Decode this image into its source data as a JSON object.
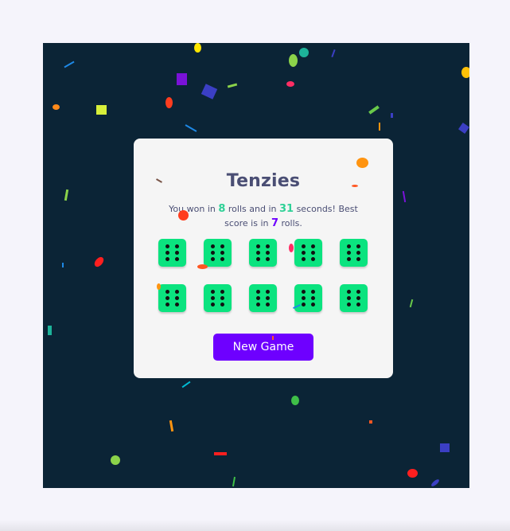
{
  "game": {
    "title": "Tenzies",
    "message": {
      "part1": "You won in ",
      "rolls": "8",
      "part2": " rolls and in ",
      "seconds": "31",
      "part3": " seconds! Best score is in ",
      "best": "7",
      "part4": " rolls."
    },
    "dice": [
      {
        "value": 6,
        "held": true
      },
      {
        "value": 6,
        "held": true
      },
      {
        "value": 6,
        "held": true
      },
      {
        "value": 6,
        "held": true
      },
      {
        "value": 6,
        "held": true
      },
      {
        "value": 6,
        "held": true
      },
      {
        "value": 6,
        "held": true
      },
      {
        "value": 6,
        "held": true
      },
      {
        "value": 6,
        "held": true
      },
      {
        "value": 6,
        "held": true
      }
    ],
    "new_game_label": "New Game"
  },
  "colors": {
    "background": "#0b2436",
    "card": "#f5f5f5",
    "die_held": "#0be37f",
    "accent_purple": "#6e00ff",
    "accent_green": "#2fd197",
    "title_text": "#4a4e74"
  }
}
